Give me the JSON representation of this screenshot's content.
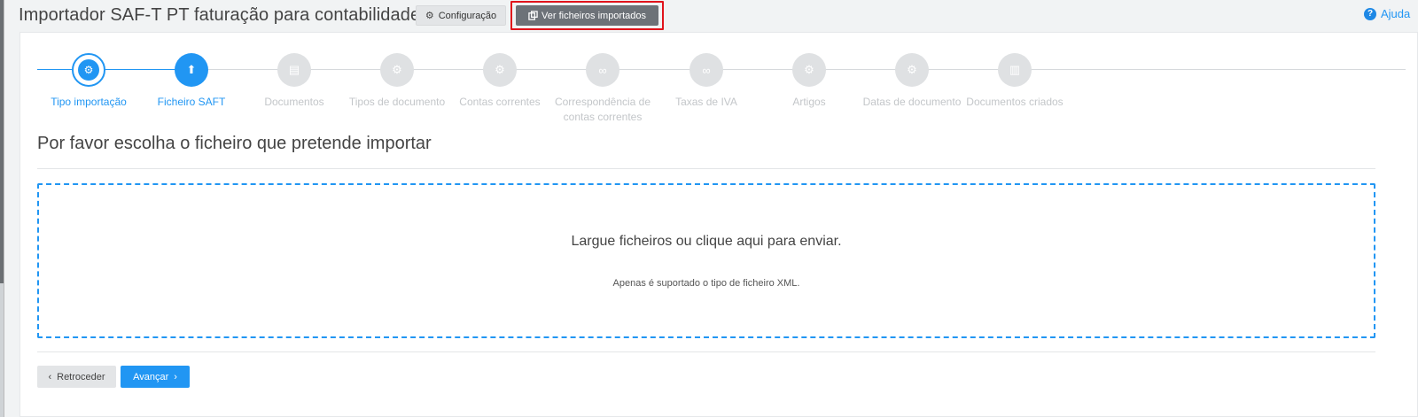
{
  "header": {
    "title": "Importador SAF-T PT faturação para contabilidade",
    "config_label": "Configuração",
    "imported_label": "Ver ficheiros importados",
    "help_label": "Ajuda"
  },
  "stepper": {
    "steps": [
      {
        "label": "Tipo importação",
        "state": "done",
        "icon": "gear-icon"
      },
      {
        "label": "Ficheiro SAFT",
        "state": "current",
        "icon": "upload-icon"
      },
      {
        "label": "Documentos",
        "state": "todo",
        "icon": "document-icon"
      },
      {
        "label": "Tipos de documento",
        "state": "todo",
        "icon": "gear-icon"
      },
      {
        "label": "Contas correntes",
        "state": "todo",
        "icon": "gears-icon"
      },
      {
        "label": "Correspondência de contas correntes",
        "state": "todo",
        "icon": "link-icon"
      },
      {
        "label": "Taxas de IVA",
        "state": "todo",
        "icon": "link-icon"
      },
      {
        "label": "Artigos",
        "state": "todo",
        "icon": "gear-icon"
      },
      {
        "label": "Datas de documento",
        "state": "todo",
        "icon": "gear-icon"
      },
      {
        "label": "Documentos criados",
        "state": "todo",
        "icon": "documents-icon"
      }
    ]
  },
  "main": {
    "section_title": "Por favor escolha o ficheiro que pretende importar",
    "dropzone_message": "Largue ficheiros ou clique aqui para enviar.",
    "dropzone_note": "Apenas é suportado o tipo de ficheiro XML."
  },
  "footer": {
    "back_label": "Retroceder",
    "next_label": "Avançar"
  },
  "colors": {
    "accent": "#2196f3",
    "highlight": "#e0131b",
    "disabled": "#dfe1e3"
  }
}
